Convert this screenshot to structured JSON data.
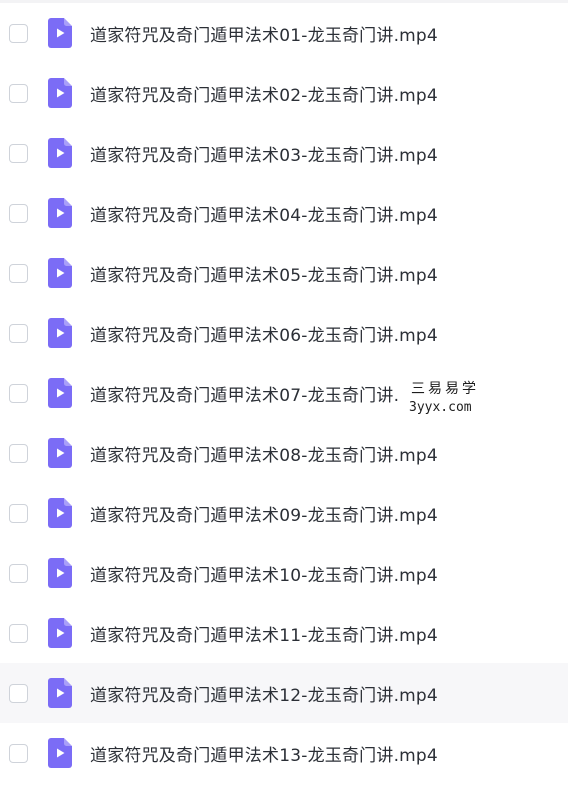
{
  "file_icon": {
    "name": "video-file-icon",
    "color": "#7b6cf6"
  },
  "files": [
    {
      "name": "道家符咒及奇门遁甲法术01-龙玉奇门讲.mp4"
    },
    {
      "name": "道家符咒及奇门遁甲法术02-龙玉奇门讲.mp4"
    },
    {
      "name": "道家符咒及奇门遁甲法术03-龙玉奇门讲.mp4"
    },
    {
      "name": "道家符咒及奇门遁甲法术04-龙玉奇门讲.mp4"
    },
    {
      "name": "道家符咒及奇门遁甲法术05-龙玉奇门讲.mp4"
    },
    {
      "name": "道家符咒及奇门遁甲法术06-龙玉奇门讲.mp4"
    },
    {
      "name": "道家符咒及奇门遁甲法术07-龙玉奇门讲.mp4"
    },
    {
      "name": "道家符咒及奇门遁甲法术08-龙玉奇门讲.mp4"
    },
    {
      "name": "道家符咒及奇门遁甲法术09-龙玉奇门讲.mp4"
    },
    {
      "name": "道家符咒及奇门遁甲法术10-龙玉奇门讲.mp4"
    },
    {
      "name": "道家符咒及奇门遁甲法术11-龙玉奇门讲.mp4"
    },
    {
      "name": "道家符咒及奇门遁甲法术12-龙玉奇门讲.mp4",
      "hovered": true
    },
    {
      "name": "道家符咒及奇门遁甲法术13-龙玉奇门讲.mp4"
    }
  ],
  "watermark": {
    "title": "三易易学",
    "url": "3yyx.com"
  }
}
